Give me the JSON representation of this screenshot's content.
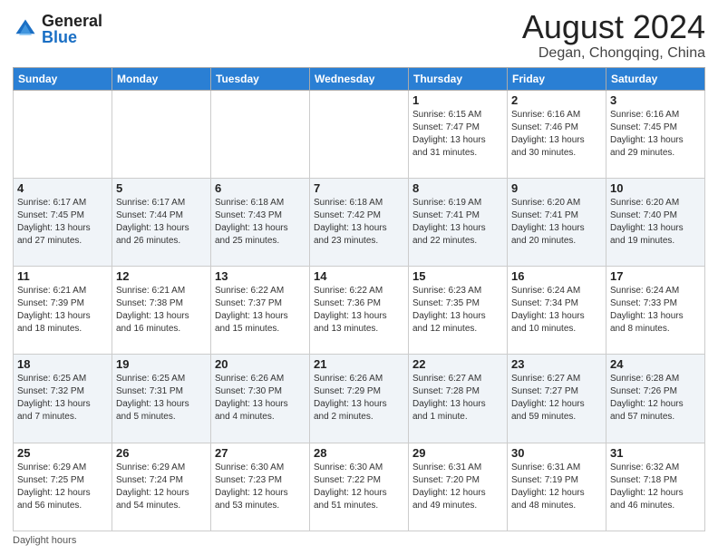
{
  "logo": {
    "general": "General",
    "blue": "Blue"
  },
  "header": {
    "month_year": "August 2024",
    "location": "Degan, Chongqing, China"
  },
  "weekdays": [
    "Sunday",
    "Monday",
    "Tuesday",
    "Wednesday",
    "Thursday",
    "Friday",
    "Saturday"
  ],
  "footer": {
    "daylight_label": "Daylight hours"
  },
  "weeks": [
    [
      {
        "day": "",
        "info": ""
      },
      {
        "day": "",
        "info": ""
      },
      {
        "day": "",
        "info": ""
      },
      {
        "day": "",
        "info": ""
      },
      {
        "day": "1",
        "info": "Sunrise: 6:15 AM\nSunset: 7:47 PM\nDaylight: 13 hours\nand 31 minutes."
      },
      {
        "day": "2",
        "info": "Sunrise: 6:16 AM\nSunset: 7:46 PM\nDaylight: 13 hours\nand 30 minutes."
      },
      {
        "day": "3",
        "info": "Sunrise: 6:16 AM\nSunset: 7:45 PM\nDaylight: 13 hours\nand 29 minutes."
      }
    ],
    [
      {
        "day": "4",
        "info": "Sunrise: 6:17 AM\nSunset: 7:45 PM\nDaylight: 13 hours\nand 27 minutes."
      },
      {
        "day": "5",
        "info": "Sunrise: 6:17 AM\nSunset: 7:44 PM\nDaylight: 13 hours\nand 26 minutes."
      },
      {
        "day": "6",
        "info": "Sunrise: 6:18 AM\nSunset: 7:43 PM\nDaylight: 13 hours\nand 25 minutes."
      },
      {
        "day": "7",
        "info": "Sunrise: 6:18 AM\nSunset: 7:42 PM\nDaylight: 13 hours\nand 23 minutes."
      },
      {
        "day": "8",
        "info": "Sunrise: 6:19 AM\nSunset: 7:41 PM\nDaylight: 13 hours\nand 22 minutes."
      },
      {
        "day": "9",
        "info": "Sunrise: 6:20 AM\nSunset: 7:41 PM\nDaylight: 13 hours\nand 20 minutes."
      },
      {
        "day": "10",
        "info": "Sunrise: 6:20 AM\nSunset: 7:40 PM\nDaylight: 13 hours\nand 19 minutes."
      }
    ],
    [
      {
        "day": "11",
        "info": "Sunrise: 6:21 AM\nSunset: 7:39 PM\nDaylight: 13 hours\nand 18 minutes."
      },
      {
        "day": "12",
        "info": "Sunrise: 6:21 AM\nSunset: 7:38 PM\nDaylight: 13 hours\nand 16 minutes."
      },
      {
        "day": "13",
        "info": "Sunrise: 6:22 AM\nSunset: 7:37 PM\nDaylight: 13 hours\nand 15 minutes."
      },
      {
        "day": "14",
        "info": "Sunrise: 6:22 AM\nSunset: 7:36 PM\nDaylight: 13 hours\nand 13 minutes."
      },
      {
        "day": "15",
        "info": "Sunrise: 6:23 AM\nSunset: 7:35 PM\nDaylight: 13 hours\nand 12 minutes."
      },
      {
        "day": "16",
        "info": "Sunrise: 6:24 AM\nSunset: 7:34 PM\nDaylight: 13 hours\nand 10 minutes."
      },
      {
        "day": "17",
        "info": "Sunrise: 6:24 AM\nSunset: 7:33 PM\nDaylight: 13 hours\nand 8 minutes."
      }
    ],
    [
      {
        "day": "18",
        "info": "Sunrise: 6:25 AM\nSunset: 7:32 PM\nDaylight: 13 hours\nand 7 minutes."
      },
      {
        "day": "19",
        "info": "Sunrise: 6:25 AM\nSunset: 7:31 PM\nDaylight: 13 hours\nand 5 minutes."
      },
      {
        "day": "20",
        "info": "Sunrise: 6:26 AM\nSunset: 7:30 PM\nDaylight: 13 hours\nand 4 minutes."
      },
      {
        "day": "21",
        "info": "Sunrise: 6:26 AM\nSunset: 7:29 PM\nDaylight: 13 hours\nand 2 minutes."
      },
      {
        "day": "22",
        "info": "Sunrise: 6:27 AM\nSunset: 7:28 PM\nDaylight: 13 hours\nand 1 minute."
      },
      {
        "day": "23",
        "info": "Sunrise: 6:27 AM\nSunset: 7:27 PM\nDaylight: 12 hours\nand 59 minutes."
      },
      {
        "day": "24",
        "info": "Sunrise: 6:28 AM\nSunset: 7:26 PM\nDaylight: 12 hours\nand 57 minutes."
      }
    ],
    [
      {
        "day": "25",
        "info": "Sunrise: 6:29 AM\nSunset: 7:25 PM\nDaylight: 12 hours\nand 56 minutes."
      },
      {
        "day": "26",
        "info": "Sunrise: 6:29 AM\nSunset: 7:24 PM\nDaylight: 12 hours\nand 54 minutes."
      },
      {
        "day": "27",
        "info": "Sunrise: 6:30 AM\nSunset: 7:23 PM\nDaylight: 12 hours\nand 53 minutes."
      },
      {
        "day": "28",
        "info": "Sunrise: 6:30 AM\nSunset: 7:22 PM\nDaylight: 12 hours\nand 51 minutes."
      },
      {
        "day": "29",
        "info": "Sunrise: 6:31 AM\nSunset: 7:20 PM\nDaylight: 12 hours\nand 49 minutes."
      },
      {
        "day": "30",
        "info": "Sunrise: 6:31 AM\nSunset: 7:19 PM\nDaylight: 12 hours\nand 48 minutes."
      },
      {
        "day": "31",
        "info": "Sunrise: 6:32 AM\nSunset: 7:18 PM\nDaylight: 12 hours\nand 46 minutes."
      }
    ]
  ]
}
